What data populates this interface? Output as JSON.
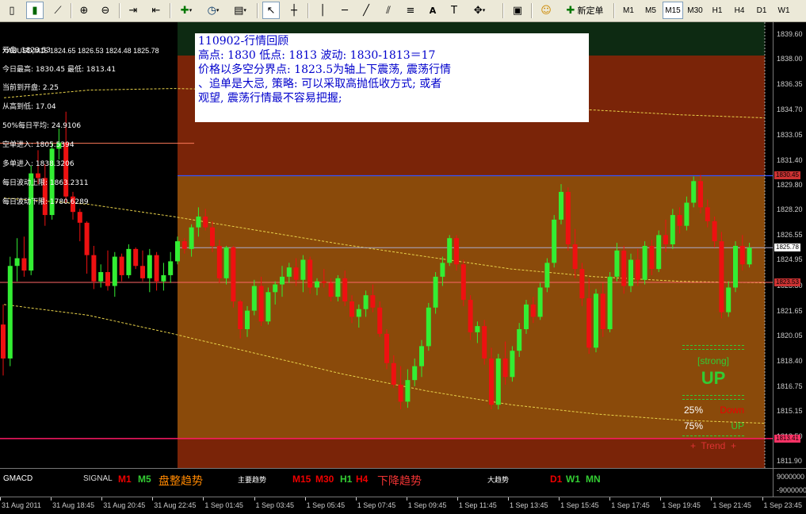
{
  "toolbar": {
    "timeframes": [
      "M1",
      "M5",
      "M15",
      "M30",
      "H1",
      "H4",
      "D1",
      "W1"
    ],
    "active_timeframe": "M15",
    "new_order_label": "新定单",
    "text_tool_label": "A"
  },
  "chart": {
    "symbol_header": "XAUUSD,M15  1824.65 1826.53 1824.48 1825.78",
    "info_lines": [
      "开盘: 1823.53",
      "今日最高: 1830.45  最低: 1813.41",
      "当前到开盘: 2.25",
      "从高到低: 17.04",
      "50%每日平均: 24.9106",
      "空单进入: 1805.5394",
      "多单进入: 1838.3206",
      "每日波动上限: 1863.2311",
      "每日波动下限: 1780.6289"
    ],
    "note_lines": [
      "110902-行情回顾",
      "高点: 1830  低点: 1813  波动: 1830-1813＝17",
      "价格以多空分界点: 1823.5为轴上下震荡, 震荡行情",
      "、追单是大忌, 策略: 可以采取高抛低收方式; 或者",
      "观望, 震荡行情最不容易把握;"
    ],
    "price_ticks": [
      "1839.60",
      "1838.00",
      "1836.35",
      "1834.70",
      "1833.05",
      "1831.40",
      "1829.80",
      "1828.20",
      "1826.55",
      "1824.95",
      "1823.30",
      "1821.65",
      "1820.05",
      "1818.40",
      "1816.75",
      "1815.15",
      "1813.50",
      "1811.90"
    ],
    "price_badges": [
      {
        "text": "1830.45",
        "color": "#cc3333"
      },
      {
        "text": "1825.78",
        "color": "#ffffff"
      },
      {
        "text": "1823.53",
        "color": "#cc3333"
      },
      {
        "text": "1813.41",
        "color": "#ff3366"
      }
    ],
    "indicator": {
      "strong": "[strong]",
      "direction": "UP",
      "pct_down": "25%",
      "down_label": "Down",
      "pct_up": "75%",
      "up_label": "UP",
      "trend": "+  Trend  +"
    }
  },
  "subwindow": {
    "title": "GMACD",
    "signal": "SIGNAL",
    "group1": [
      "M1",
      "M5"
    ],
    "group1_text": "盘整趋势",
    "group2_title": "主要趋势",
    "group2": [
      "M15",
      "M30",
      "H1",
      "H4"
    ],
    "group2_text": "下降趋势",
    "group3_title": "大趋势",
    "group3": [
      "D1",
      "W1",
      "MN"
    ],
    "axis_top": "9000000",
    "axis_bottom": "-9000000"
  },
  "time_axis": [
    "31 Aug 2011",
    "31 Aug 18:45",
    "31 Aug 20:45",
    "31 Aug 22:45",
    "1 Sep 01:45",
    "1 Sep 03:45",
    "1 Sep 05:45",
    "1 Sep 07:45",
    "1 Sep 09:45",
    "1 Sep 11:45",
    "1 Sep 13:45",
    "1 Sep 15:45",
    "1 Sep 17:45",
    "1 Sep 19:45",
    "1 Sep 21:45",
    "1 Sep 23:45"
  ],
  "chart_data": {
    "type": "candlestick",
    "candles_ohlc": [
      [
        1820.8,
        1822.1,
        1817.5,
        1818.6
      ],
      [
        1818.6,
        1825.2,
        1818.1,
        1824.6
      ],
      [
        1824.6,
        1826.4,
        1823.6,
        1825.1
      ],
      [
        1825.1,
        1826.5,
        1823.9,
        1824.3
      ],
      [
        1824.3,
        1831.1,
        1824.0,
        1830.6
      ],
      [
        1830.6,
        1832.1,
        1829.9,
        1830.3
      ],
      [
        1830.3,
        1831.2,
        1827.2,
        1827.9
      ],
      [
        1827.9,
        1832.6,
        1827.6,
        1832.2
      ],
      [
        1832.2,
        1833.5,
        1831.5,
        1832.6
      ],
      [
        1832.6,
        1834.6,
        1828.7,
        1829.1
      ],
      [
        1829.1,
        1829.4,
        1827.6,
        1828.1
      ],
      [
        1828.1,
        1828.3,
        1826.2,
        1827.4
      ],
      [
        1827.4,
        1827.5,
        1824.1,
        1825.3
      ],
      [
        1825.3,
        1825.9,
        1823.1,
        1823.6
      ],
      [
        1823.6,
        1824.7,
        1823.2,
        1824.2
      ],
      [
        1824.2,
        1825.6,
        1823.0,
        1823.3
      ],
      [
        1823.3,
        1825.5,
        1822.6,
        1825.2
      ],
      [
        1825.2,
        1825.4,
        1823.6,
        1824.0
      ],
      [
        1824.0,
        1826.0,
        1823.8,
        1825.7
      ],
      [
        1825.7,
        1825.8,
        1824.4,
        1824.6
      ],
      [
        1824.6,
        1825.6,
        1823.6,
        1823.8
      ],
      [
        1823.8,
        1825.7,
        1822.9,
        1825.3
      ],
      [
        1825.3,
        1825.5,
        1823.0,
        1823.6
      ],
      [
        1823.6,
        1824.8,
        1823.0,
        1824.0
      ],
      [
        1824.0,
        1825.5,
        1823.5,
        1824.9
      ],
      [
        1824.9,
        1826.5,
        1824.7,
        1826.2
      ],
      [
        1826.2,
        1826.4,
        1825.4,
        1825.7
      ],
      [
        1825.7,
        1827.3,
        1825.2,
        1827.1
      ],
      [
        1827.1,
        1828.4,
        1826.5,
        1827.8
      ],
      [
        1827.8,
        1828.3,
        1826.9,
        1827.1
      ],
      [
        1827.1,
        1827.5,
        1825.5,
        1825.9
      ],
      [
        1825.9,
        1826.3,
        1823.5,
        1823.8
      ],
      [
        1823.8,
        1825.9,
        1823.4,
        1825.8
      ],
      [
        1825.8,
        1825.9,
        1821.9,
        1822.3
      ],
      [
        1822.3,
        1822.4,
        1819.9,
        1820.5
      ],
      [
        1820.5,
        1822.0,
        1820.0,
        1821.7
      ],
      [
        1821.7,
        1823.7,
        1821.4,
        1823.3
      ],
      [
        1823.3,
        1823.9,
        1820.7,
        1821.0
      ],
      [
        1821.0,
        1823.2,
        1820.8,
        1822.9
      ],
      [
        1822.9,
        1823.6,
        1822.1,
        1823.4
      ],
      [
        1823.4,
        1824.6,
        1822.6,
        1823.9
      ],
      [
        1823.9,
        1824.8,
        1823.5,
        1824.5
      ],
      [
        1824.5,
        1825.1,
        1823.3,
        1823.7
      ],
      [
        1823.7,
        1825.3,
        1822.9,
        1825.0
      ],
      [
        1825.0,
        1825.2,
        1822.8,
        1823.2
      ],
      [
        1823.2,
        1823.8,
        1822.7,
        1823.6
      ],
      [
        1823.6,
        1824.4,
        1823.2,
        1823.5
      ],
      [
        1823.5,
        1823.8,
        1822.3,
        1822.6
      ],
      [
        1822.6,
        1824.0,
        1822.3,
        1823.8
      ],
      [
        1823.8,
        1824.3,
        1822.0,
        1822.3
      ],
      [
        1822.3,
        1822.7,
        1820.9,
        1821.3
      ],
      [
        1821.3,
        1822.1,
        1820.6,
        1821.8
      ],
      [
        1821.8,
        1823.0,
        1821.3,
        1822.7
      ],
      [
        1822.7,
        1823.4,
        1821.6,
        1821.9
      ],
      [
        1821.9,
        1822.3,
        1820.0,
        1820.2
      ],
      [
        1820.2,
        1820.5,
        1817.9,
        1818.3
      ],
      [
        1818.3,
        1818.8,
        1816.7,
        1816.9
      ],
      [
        1816.9,
        1818.1,
        1815.3,
        1815.8
      ],
      [
        1815.8,
        1817.9,
        1815.4,
        1817.2
      ],
      [
        1817.2,
        1818.6,
        1816.8,
        1818.1
      ],
      [
        1818.1,
        1819.8,
        1817.4,
        1819.4
      ],
      [
        1819.4,
        1822.2,
        1819.1,
        1821.9
      ],
      [
        1821.9,
        1824.2,
        1821.5,
        1823.9
      ],
      [
        1823.9,
        1825.2,
        1823.3,
        1824.8
      ],
      [
        1824.8,
        1826.6,
        1824.6,
        1826.4
      ],
      [
        1826.4,
        1826.6,
        1824.3,
        1824.7
      ],
      [
        1824.7,
        1825.0,
        1822.0,
        1822.4
      ],
      [
        1822.4,
        1822.7,
        1819.8,
        1820.3
      ],
      [
        1820.3,
        1821.0,
        1819.6,
        1820.7
      ],
      [
        1820.7,
        1821.1,
        1818.2,
        1818.6
      ],
      [
        1818.6,
        1819.3,
        1815.3,
        1815.6
      ],
      [
        1815.6,
        1818.9,
        1815.3,
        1818.6
      ],
      [
        1818.6,
        1819.7,
        1816.9,
        1817.4
      ],
      [
        1817.4,
        1819.4,
        1817.1,
        1819.1
      ],
      [
        1819.1,
        1820.9,
        1818.7,
        1820.5
      ],
      [
        1820.5,
        1822.4,
        1820.2,
        1822.1
      ],
      [
        1822.1,
        1822.6,
        1820.9,
        1821.3
      ],
      [
        1821.3,
        1823.5,
        1821.1,
        1823.2
      ],
      [
        1823.2,
        1825.1,
        1822.9,
        1824.8
      ],
      [
        1824.8,
        1827.9,
        1824.5,
        1827.6
      ],
      [
        1827.6,
        1829.9,
        1827.3,
        1829.4
      ],
      [
        1829.4,
        1829.7,
        1825.6,
        1826.0
      ],
      [
        1826.0,
        1827.0,
        1823.8,
        1824.4
      ],
      [
        1824.4,
        1824.8,
        1822.0,
        1822.5
      ],
      [
        1822.5,
        1823.8,
        1818.9,
        1819.3
      ],
      [
        1819.3,
        1823.1,
        1819.0,
        1822.8
      ],
      [
        1822.8,
        1823.5,
        1820.0,
        1820.5
      ],
      [
        1820.5,
        1824.2,
        1820.3,
        1823.9
      ],
      [
        1823.9,
        1826.1,
        1823.6,
        1825.6
      ],
      [
        1825.6,
        1825.9,
        1822.8,
        1823.3
      ],
      [
        1823.3,
        1825.4,
        1822.9,
        1825.0
      ],
      [
        1825.0,
        1825.7,
        1823.3,
        1823.7
      ],
      [
        1823.7,
        1826.2,
        1823.4,
        1825.9
      ],
      [
        1825.9,
        1826.3,
        1824.0,
        1824.4
      ],
      [
        1824.4,
        1826.9,
        1824.2,
        1826.6
      ],
      [
        1826.6,
        1827.6,
        1825.5,
        1826.0
      ],
      [
        1826.0,
        1828.3,
        1825.7,
        1827.9
      ],
      [
        1827.9,
        1828.4,
        1826.7,
        1827.2
      ],
      [
        1827.2,
        1829.1,
        1826.9,
        1828.7
      ],
      [
        1828.7,
        1830.4,
        1828.4,
        1830.1
      ],
      [
        1830.1,
        1830.5,
        1828.0,
        1828.4
      ],
      [
        1828.4,
        1828.9,
        1827.1,
        1827.5
      ],
      [
        1827.5,
        1827.8,
        1825.8,
        1826.2
      ],
      [
        1826.2,
        1826.8,
        1821.2,
        1821.6
      ],
      [
        1821.6,
        1823.6,
        1821.3,
        1823.2
      ],
      [
        1823.2,
        1826.2,
        1822.9,
        1825.9
      ],
      [
        1825.9,
        1826.6,
        1824.3,
        1824.7
      ],
      [
        1824.7,
        1826.1,
        1824.5,
        1825.78
      ]
    ],
    "series": [
      {
        "name": "Bands-upper",
        "values": [
          1835.5,
          1836.0,
          1836.1,
          1836.0,
          1835.6,
          1835.3,
          1834.9,
          1834.7,
          1834.4,
          1834.2
        ]
      },
      {
        "name": "Bands-middle",
        "values": [
          1829.0,
          1828.6,
          1827.8,
          1826.9,
          1826.0,
          1825.2,
          1824.4,
          1823.9,
          1823.6,
          1823.5
        ]
      },
      {
        "name": "Bands-lower",
        "values": [
          1822.1,
          1821.4,
          1820.2,
          1818.9,
          1817.6,
          1816.5,
          1815.6,
          1815.0,
          1814.6,
          1814.4
        ]
      }
    ],
    "ylim": [
      1811.5,
      1840.4
    ]
  }
}
